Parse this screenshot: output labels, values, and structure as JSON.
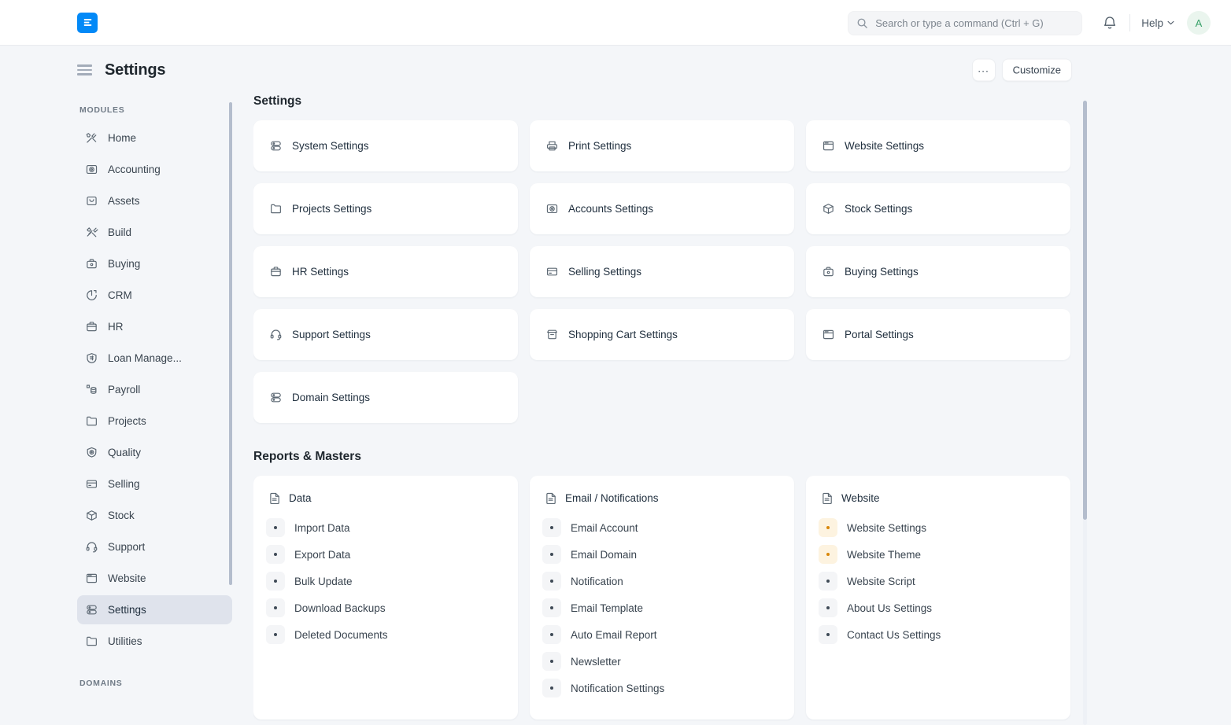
{
  "navbar": {
    "brand_icon": "erpnext-logo-icon",
    "brand_color": "#0289f7",
    "search": {
      "placeholder": "Search or type a command (Ctrl + G)",
      "value": "",
      "icon": "search-icon"
    },
    "notification_icon": "bell-icon",
    "help_label": "Help",
    "help_caret_icon": "chevron-down-icon",
    "avatar_initial": "A",
    "avatar_bg": "#eaf5ee",
    "avatar_color": "#38a169"
  },
  "page": {
    "menu_icon": "hamburger-icon",
    "title": "Settings",
    "more_label": "...",
    "customize_label": "Customize"
  },
  "sidebar": {
    "modules_heading": "MODULES",
    "domains_heading": "DOMAINS",
    "items": [
      {
        "label": "Home",
        "icon": "tools-icon",
        "active": false
      },
      {
        "label": "Accounting",
        "icon": "accounting-icon",
        "active": false
      },
      {
        "label": "Assets",
        "icon": "assets-icon",
        "active": false
      },
      {
        "label": "Build",
        "icon": "build-icon",
        "active": false
      },
      {
        "label": "Buying",
        "icon": "buying-icon",
        "active": false
      },
      {
        "label": "CRM",
        "icon": "crm-pie-icon",
        "active": false
      },
      {
        "label": "HR",
        "icon": "hr-briefcase-icon",
        "active": false
      },
      {
        "label": "Loan Manage...",
        "icon": "loan-icon",
        "active": false
      },
      {
        "label": "Payroll",
        "icon": "payroll-icon",
        "active": false
      },
      {
        "label": "Projects",
        "icon": "folder-icon",
        "active": false
      },
      {
        "label": "Quality",
        "icon": "quality-shield-icon",
        "active": false
      },
      {
        "label": "Selling",
        "icon": "selling-card-icon",
        "active": false
      },
      {
        "label": "Stock",
        "icon": "stock-box-icon",
        "active": false
      },
      {
        "label": "Support",
        "icon": "headset-icon",
        "active": false
      },
      {
        "label": "Website",
        "icon": "window-icon",
        "active": false
      },
      {
        "label": "Settings",
        "icon": "settings-server-icon",
        "active": true
      },
      {
        "label": "Utilities",
        "icon": "folder-icon",
        "active": false
      }
    ]
  },
  "main": {
    "settings_section": {
      "title": "Settings",
      "tiles": [
        {
          "label": "System Settings",
          "icon": "server-icon"
        },
        {
          "label": "Print Settings",
          "icon": "printer-icon"
        },
        {
          "label": "Website Settings",
          "icon": "window-icon"
        },
        {
          "label": "Projects Settings",
          "icon": "folder-icon"
        },
        {
          "label": "Accounts Settings",
          "icon": "accounting-icon"
        },
        {
          "label": "Stock Settings",
          "icon": "stock-box-icon"
        },
        {
          "label": "HR Settings",
          "icon": "hr-briefcase-icon"
        },
        {
          "label": "Selling Settings",
          "icon": "selling-card-icon"
        },
        {
          "label": "Buying Settings",
          "icon": "buying-icon"
        },
        {
          "label": "Support Settings",
          "icon": "headset-icon"
        },
        {
          "label": "Shopping Cart Settings",
          "icon": "shopping-cart-icon"
        },
        {
          "label": "Portal Settings",
          "icon": "window-icon"
        },
        {
          "label": "Domain Settings",
          "icon": "server-icon"
        }
      ]
    },
    "reports_section": {
      "title": "Reports & Masters",
      "cards": [
        {
          "title": "Data",
          "icon": "document-icon",
          "links": [
            {
              "label": "Import Data",
              "highlight": false
            },
            {
              "label": "Export Data",
              "highlight": false
            },
            {
              "label": "Bulk Update",
              "highlight": false
            },
            {
              "label": "Download Backups",
              "highlight": false
            },
            {
              "label": "Deleted Documents",
              "highlight": false
            }
          ]
        },
        {
          "title": "Email / Notifications",
          "icon": "document-icon",
          "links": [
            {
              "label": "Email Account",
              "highlight": false
            },
            {
              "label": "Email Domain",
              "highlight": false
            },
            {
              "label": "Notification",
              "highlight": false
            },
            {
              "label": "Email Template",
              "highlight": false
            },
            {
              "label": "Auto Email Report",
              "highlight": false
            },
            {
              "label": "Newsletter",
              "highlight": false
            },
            {
              "label": "Notification Settings",
              "highlight": false
            }
          ]
        },
        {
          "title": "Website",
          "icon": "document-icon",
          "links": [
            {
              "label": "Website Settings",
              "highlight": true
            },
            {
              "label": "Website Theme",
              "highlight": true
            },
            {
              "label": "Website Script",
              "highlight": false
            },
            {
              "label": "About Us Settings",
              "highlight": false
            },
            {
              "label": "Contact Us Settings",
              "highlight": false
            }
          ]
        }
      ]
    }
  },
  "colors": {
    "page_bg": "#f4f6f9",
    "card_bg": "#ffffff",
    "accent": "#0289f7",
    "active_sidebar": "#dfe3ec",
    "highlight_bullet": "#d9870a",
    "scrollbar": "#b4bdcd"
  }
}
